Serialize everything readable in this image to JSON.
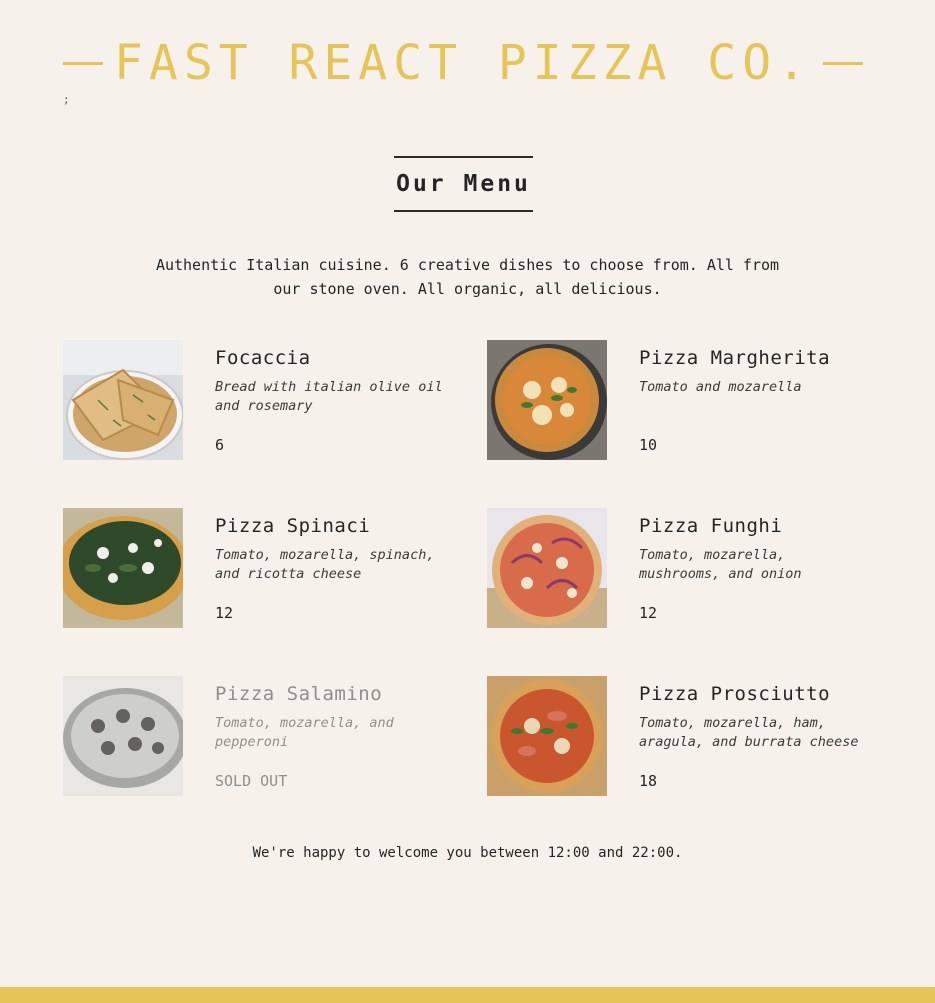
{
  "header": {
    "title": "Fast React Pizza Co."
  },
  "stray_text": ";",
  "menu": {
    "title": "Our Menu",
    "intro": "Authentic Italian cuisine. 6 creative dishes to choose from. All from our stone oven. All organic, all delicious."
  },
  "pizzas": [
    {
      "name": "Focaccia",
      "ingredients": "Bread with italian olive oil and rosemary",
      "price": "6",
      "sold_out": false
    },
    {
      "name": "Pizza Margherita",
      "ingredients": "Tomato and mozarella",
      "price": "10",
      "sold_out": false
    },
    {
      "name": "Pizza Spinaci",
      "ingredients": "Tomato, mozarella, spinach, and ricotta cheese",
      "price": "12",
      "sold_out": false
    },
    {
      "name": "Pizza Funghi",
      "ingredients": "Tomato, mozarella, mushrooms, and onion",
      "price": "12",
      "sold_out": false
    },
    {
      "name": "Pizza Salamino",
      "ingredients": "Tomato, mozarella, and pepperoni",
      "price": "SOLD OUT",
      "sold_out": true
    },
    {
      "name": "Pizza Prosciutto",
      "ingredients": "Tomato, mozarella, ham, aragula, and burrata cheese",
      "price": "18",
      "sold_out": false
    }
  ],
  "footer": {
    "text": "We're happy to welcome you between 12:00 and 22:00."
  },
  "colors": {
    "accent": "#e5c558",
    "background": "#f6f2eb",
    "text": "#252525",
    "muted": "#8f8f8f"
  }
}
